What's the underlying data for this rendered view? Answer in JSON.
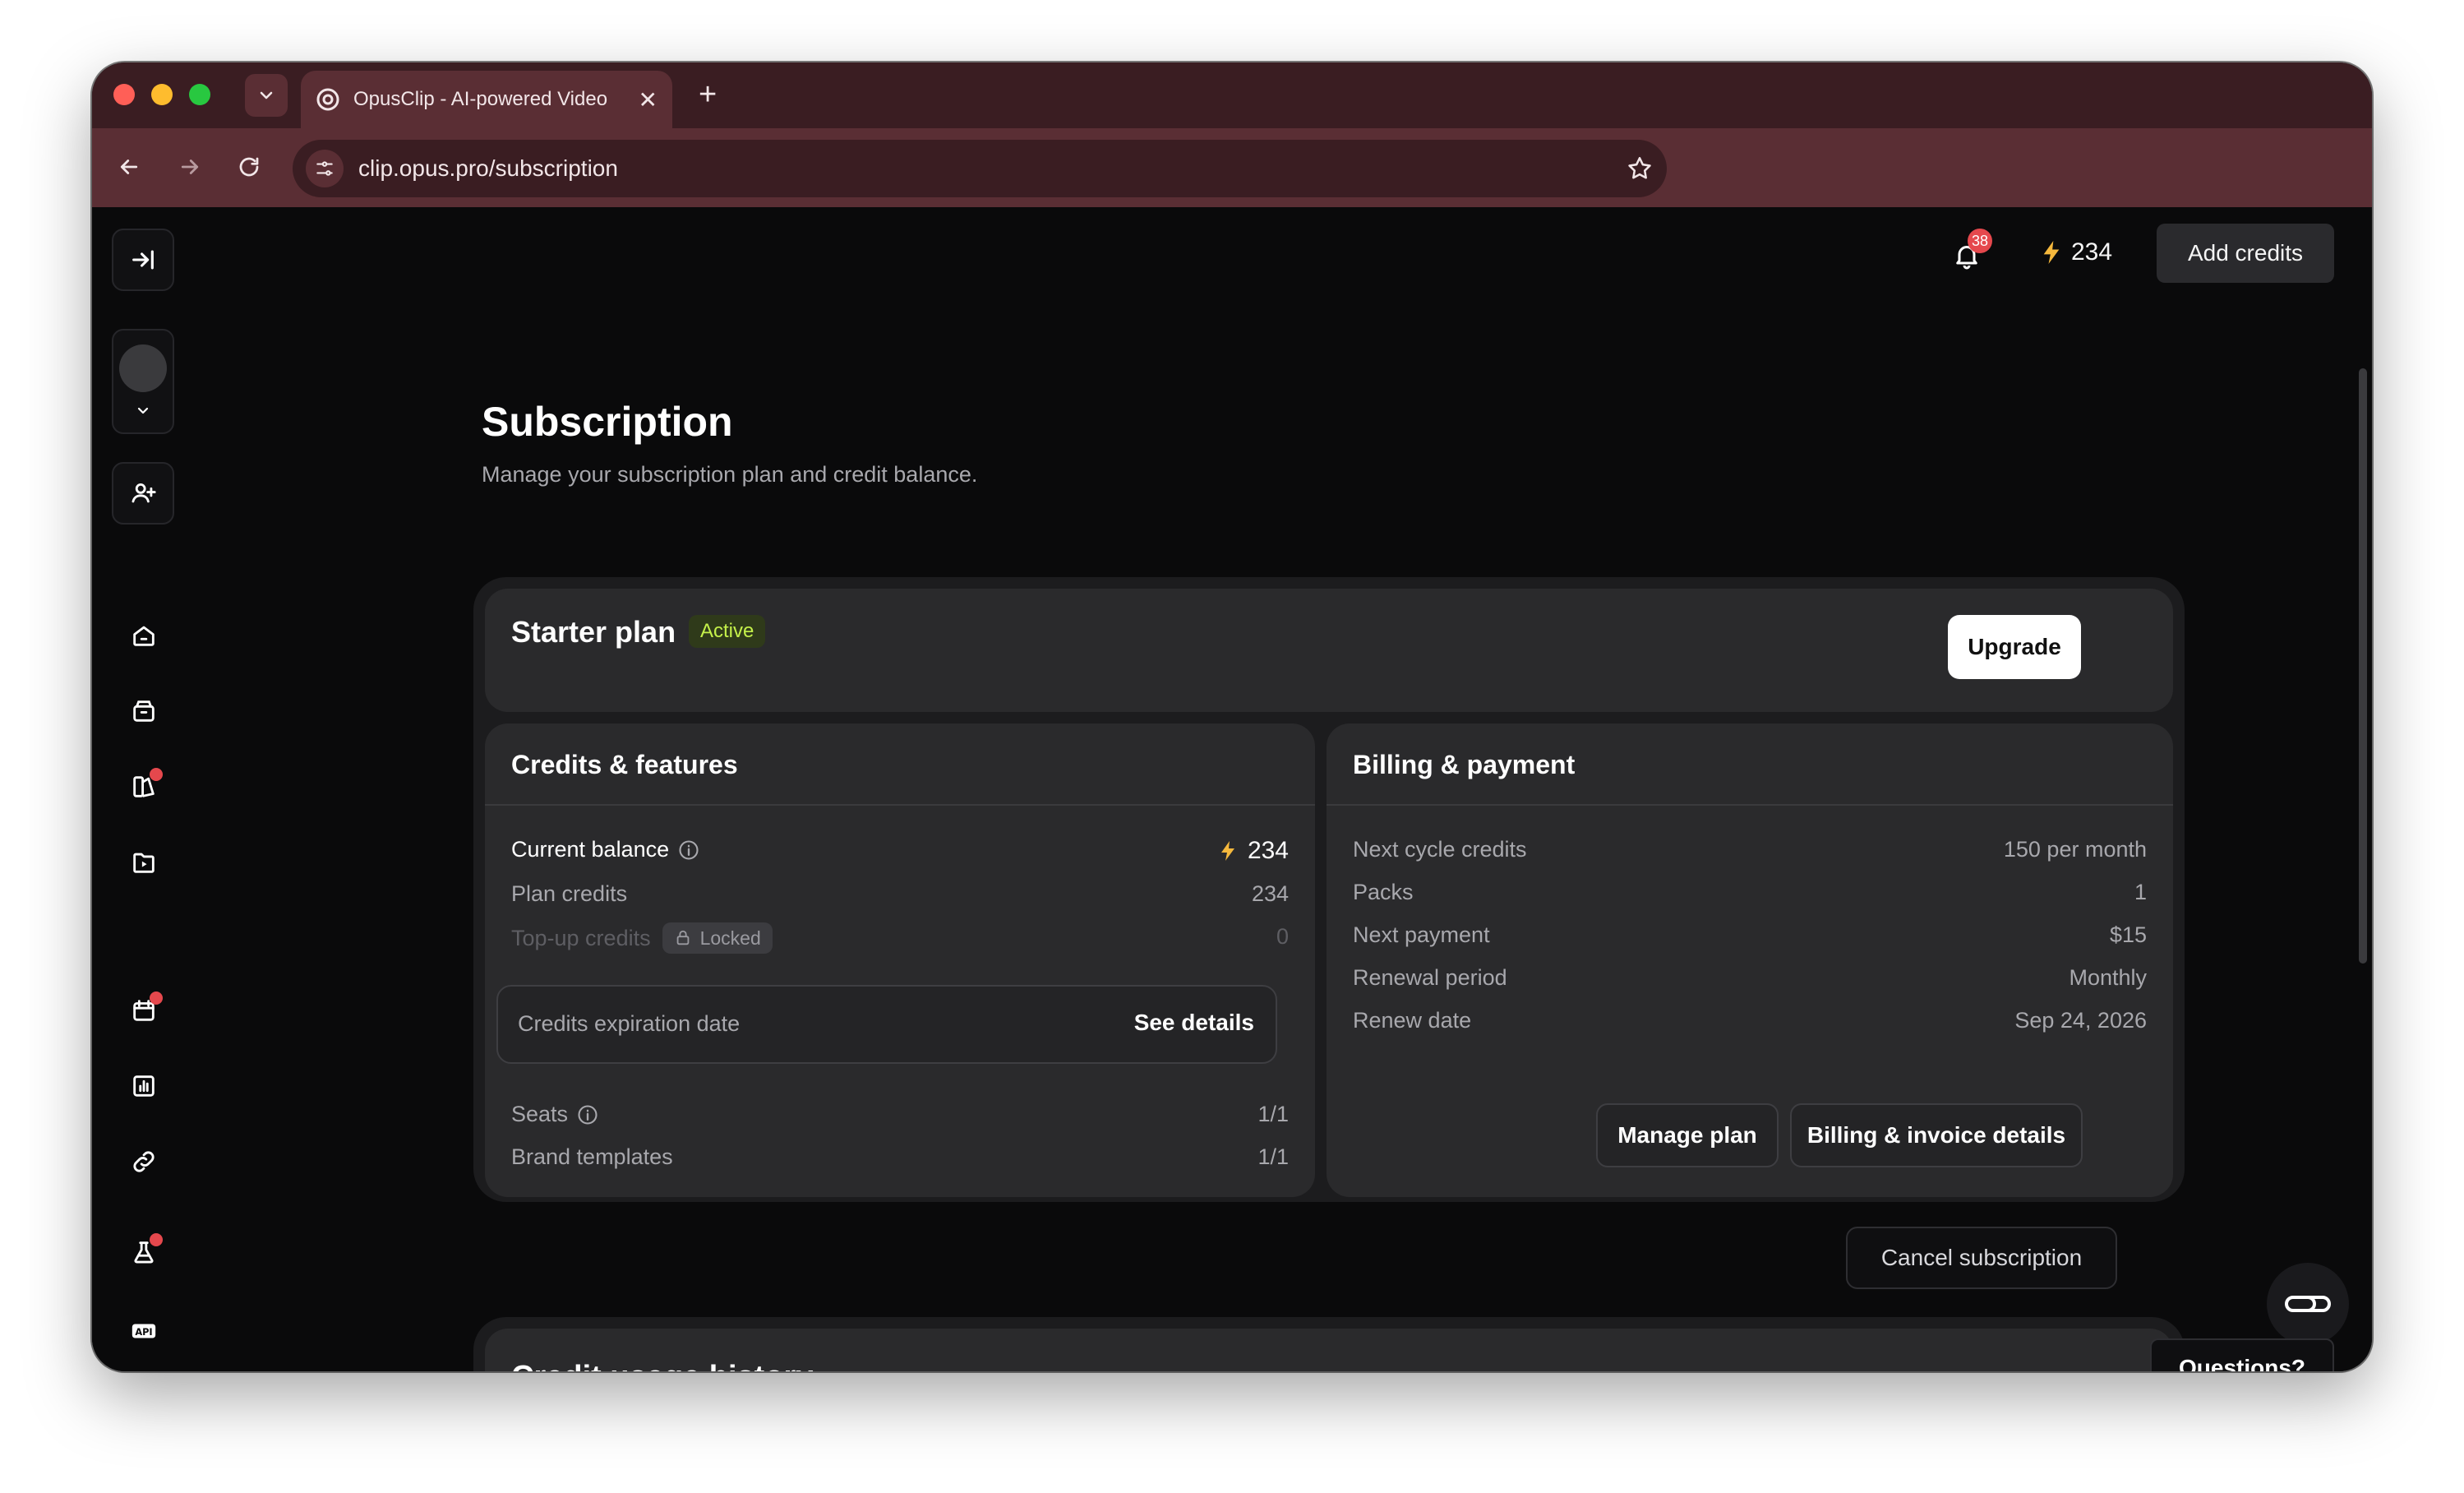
{
  "browser": {
    "tab_title": "OpusClip - AI-powered Video",
    "url": "clip.opus.pro/subscription"
  },
  "topbar": {
    "notification_count": "38",
    "credits": "234",
    "add_credits_label": "Add credits"
  },
  "page": {
    "title": "Subscription",
    "subtitle": "Manage your subscription plan and credit balance."
  },
  "plan": {
    "name": "Starter plan",
    "status": "Active",
    "upgrade_label": "Upgrade"
  },
  "credits_features": {
    "title": "Credits & features",
    "current_balance_label": "Current balance",
    "current_balance_value": "234",
    "plan_credits_label": "Plan credits",
    "plan_credits_value": "234",
    "topup_label": "Top-up credits",
    "topup_badge": "Locked",
    "topup_value": "0",
    "expiration_label": "Credits expiration date",
    "see_details_label": "See details",
    "seats_label": "Seats",
    "seats_value": "1/1",
    "brand_templates_label": "Brand templates",
    "brand_templates_value": "1/1"
  },
  "billing": {
    "title": "Billing & payment",
    "rows": [
      {
        "label": "Next cycle credits",
        "value": "150 per month"
      },
      {
        "label": "Packs",
        "value": "1"
      },
      {
        "label": "Next payment",
        "value": "$15"
      },
      {
        "label": "Renewal period",
        "value": "Monthly"
      },
      {
        "label": "Renew date",
        "value": "Sep 24, 2026"
      }
    ],
    "manage_plan_label": "Manage plan",
    "invoice_label": "Billing & invoice details"
  },
  "cancel_label": "Cancel subscription",
  "history": {
    "title": "Credit usage history"
  },
  "help": {
    "questions_label": "Questions?"
  },
  "colors": {
    "accent_bolt": "#f5b83d",
    "active_badge": "#c4f04a",
    "notification_red": "#e5484d",
    "chrome": "#5a2e34"
  }
}
